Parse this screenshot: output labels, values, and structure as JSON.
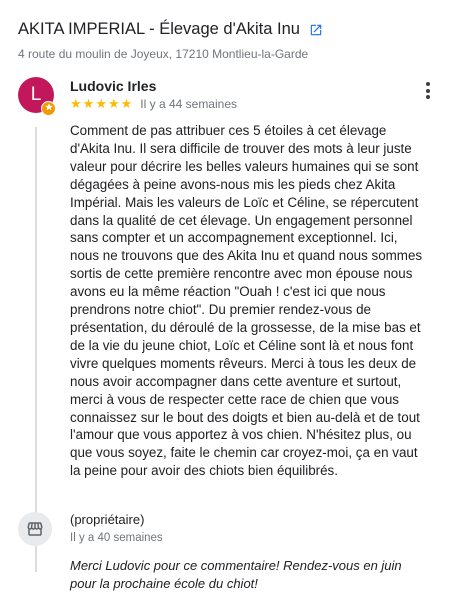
{
  "header": {
    "title": "AKITA IMPERIAL - Élevage d'Akita Inu",
    "address": "4 route du moulin de Joyeux, 17210 Montlieu-la-Garde"
  },
  "review": {
    "avatar_letter": "L",
    "author": "Ludovic Irles",
    "rating": 5,
    "stars": [
      "★",
      "★",
      "★",
      "★",
      "★"
    ],
    "time": "Il y a 44 semaines",
    "text": "Comment de pas attribuer ces 5 étoiles à cet élevage d'Akita Inu. Il sera difficile de trouver des mots à leur juste valeur pour décrire les belles valeurs humaines qui se sont dégagées à peine avons-nous mis les pieds chez Akita Impérial. Mais les valeurs de Loïc et Céline, se répercutent dans la qualité de cet élevage. Un engagement personnel sans compter et un accompagnement exceptionnel. Ici, nous ne trouvons que des Akita Inu et quand nous sommes sortis de cette première rencontre avec mon épouse nous avons eu la même réaction \"Ouah ! c'est ici que nous prendrons notre chiot\". Du premier rendez-vous de présentation, du déroulé de la grossesse, de la mise bas et de la vie du jeune chiot, Loïc et Céline sont là et nous font vivre quelques moments rêveurs. Merci à tous les deux de nous avoir accompagner dans cette aventure et surtout, merci à vous de respecter cette race de chien que vous connaissez sur le bout des doigts et bien au-delà et de tout l'amour que vous apportez à vos chien. N'hésitez plus, ou que vous soyez, faite le chemin car croyez-moi, ça en vaut la peine pour avoir des chiots bien équilibrés."
  },
  "owner_reply": {
    "label": "(propriétaire)",
    "time": "Il y a 40 semaines",
    "text": "Merci Ludovic pour ce commentaire! Rendez-vous en juin pour la prochaine école du chiot!"
  },
  "colors": {
    "avatar": "#c2185b",
    "star": "#fbbc04",
    "link_icon": "#1a73e8",
    "local_guide_badge": "#f29900"
  },
  "icons": {
    "external": "external-link-icon",
    "more": "more-vert-icon",
    "owner": "storefront-icon"
  }
}
